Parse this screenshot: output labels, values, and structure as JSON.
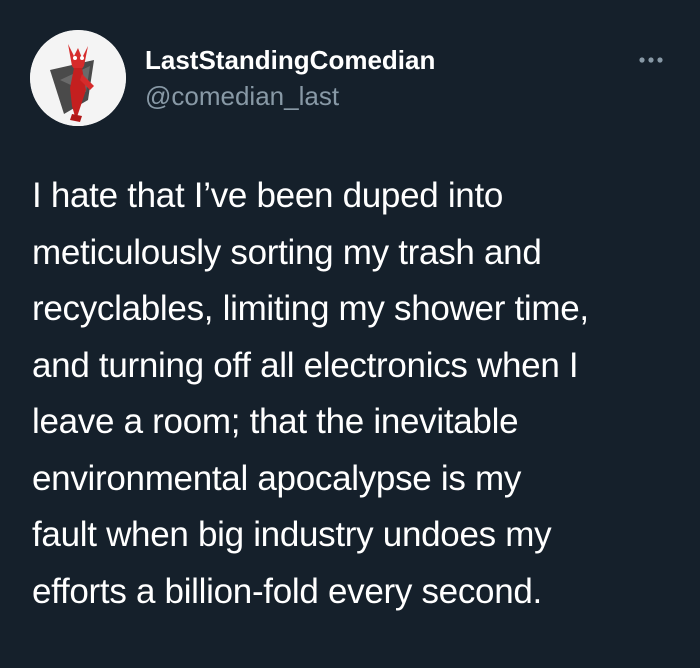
{
  "author": {
    "display_name": "LastStandingComedian",
    "handle": "@comedian_last",
    "avatar_icon": "red-devil-character-avatar"
  },
  "more_icon": "more-options-icon",
  "tweet": {
    "lines": [
      "I hate that I’ve been duped into",
      "meticulously sorting my trash and",
      "recyclables, limiting my shower time,",
      "and turning off all electronics when I",
      "leave a room; that the inevitable",
      "environmental apocalypse is my",
      "fault when big industry undoes my",
      "efforts a billion-fold every second."
    ]
  },
  "colors": {
    "background": "#15202b",
    "text_primary": "#ffffff",
    "text_secondary": "#8899a6"
  }
}
